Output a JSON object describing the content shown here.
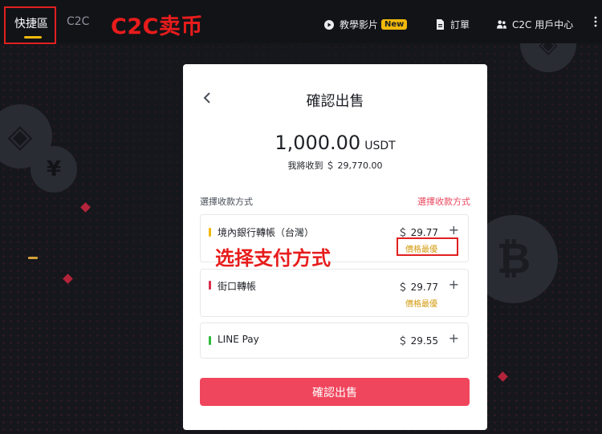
{
  "nav": {
    "tab_fast": "快捷區",
    "tab_c2c": "C2C",
    "tutorial_label": "教學影片",
    "tutorial_badge": "New",
    "orders_label": "訂單",
    "user_center_label": "C2C 用戶中心",
    "more_icon": "more-icon"
  },
  "annotations": {
    "title": "C2C卖币",
    "select_payment": "选择支付方式"
  },
  "modal": {
    "title": "確認出售",
    "amount_value": "1,000.00",
    "amount_unit": "USDT",
    "receive_text": "我將收到 ＄ 29,770.00",
    "payment_method_label": "選擇收款方式",
    "payment_method_link": "選擇收款方式",
    "methods": [
      {
        "name": "境內銀行轉帳（台灣）",
        "price": "＄ 29.77",
        "tag": "價格最優",
        "bar_color": "#f0b90b"
      },
      {
        "name": "街口轉帳",
        "price": "＄ 29.77",
        "tag": "價格最優",
        "bar_color": "#d9304f"
      },
      {
        "name": "LINE Pay",
        "price": "＄ 29.55",
        "tag": "",
        "bar_color": "#2ebd3c"
      }
    ],
    "confirm_button": "確認出售"
  },
  "colors": {
    "accent_yellow": "#f0b90b",
    "accent_pink": "#f0465d",
    "annotation_red": "#e81c1c"
  }
}
